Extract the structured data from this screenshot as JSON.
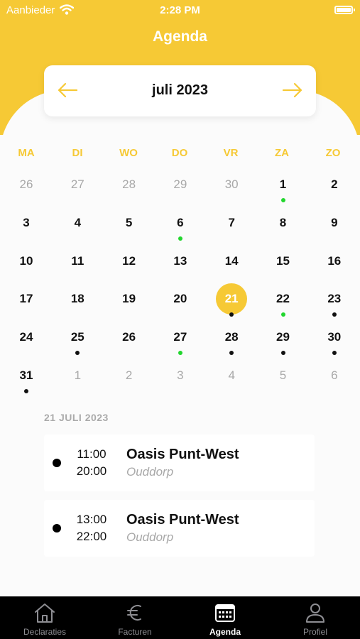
{
  "status_bar": {
    "carrier": "Aanbieder",
    "time": "2:28 PM"
  },
  "header": {
    "title": "Agenda"
  },
  "calendar": {
    "month": "juli 2023",
    "weekdays": [
      "MA",
      "DI",
      "WO",
      "DO",
      "VR",
      "ZA",
      "ZO"
    ],
    "weeks": [
      [
        {
          "d": "26",
          "muted": true
        },
        {
          "d": "27",
          "muted": true
        },
        {
          "d": "28",
          "muted": true
        },
        {
          "d": "29",
          "muted": true
        },
        {
          "d": "30",
          "muted": true
        },
        {
          "d": "1",
          "dot": "green"
        },
        {
          "d": "2"
        }
      ],
      [
        {
          "d": "3"
        },
        {
          "d": "4"
        },
        {
          "d": "5"
        },
        {
          "d": "6",
          "dot": "green"
        },
        {
          "d": "7"
        },
        {
          "d": "8"
        },
        {
          "d": "9"
        }
      ],
      [
        {
          "d": "10"
        },
        {
          "d": "11"
        },
        {
          "d": "12"
        },
        {
          "d": "13"
        },
        {
          "d": "14"
        },
        {
          "d": "15"
        },
        {
          "d": "16"
        }
      ],
      [
        {
          "d": "17"
        },
        {
          "d": "18"
        },
        {
          "d": "19"
        },
        {
          "d": "20"
        },
        {
          "d": "21",
          "selected": true,
          "dot": "black"
        },
        {
          "d": "22",
          "dot": "green"
        },
        {
          "d": "23",
          "dot": "black"
        }
      ],
      [
        {
          "d": "24"
        },
        {
          "d": "25",
          "dot": "black"
        },
        {
          "d": "26"
        },
        {
          "d": "27",
          "dot": "green"
        },
        {
          "d": "28",
          "dot": "black"
        },
        {
          "d": "29",
          "dot": "black"
        },
        {
          "d": "30",
          "dot": "black"
        }
      ],
      [
        {
          "d": "31",
          "dot": "black"
        },
        {
          "d": "1",
          "muted": true
        },
        {
          "d": "2",
          "muted": true
        },
        {
          "d": "3",
          "muted": true
        },
        {
          "d": "4",
          "muted": true
        },
        {
          "d": "5",
          "muted": true
        },
        {
          "d": "6",
          "muted": true
        }
      ]
    ]
  },
  "agenda": {
    "date_heading": "21 JULI 2023",
    "events": [
      {
        "start": "11:00",
        "end": "20:00",
        "title": "Oasis Punt-West",
        "subtitle": "Ouddorp"
      },
      {
        "start": "13:00",
        "end": "22:00",
        "title": "Oasis Punt-West",
        "subtitle": "Ouddorp"
      }
    ]
  },
  "tabs": [
    {
      "label": "Declaraties",
      "icon": "house-icon",
      "active": false
    },
    {
      "label": "Facturen",
      "icon": "euro-icon",
      "active": false
    },
    {
      "label": "Agenda",
      "icon": "calendar-icon",
      "active": true
    },
    {
      "label": "Profiel",
      "icon": "person-icon",
      "active": false
    }
  ],
  "colors": {
    "accent": "#f6c935",
    "dot_green": "#22d62e",
    "dot_black": "#111111",
    "tabbar": "#000000"
  }
}
